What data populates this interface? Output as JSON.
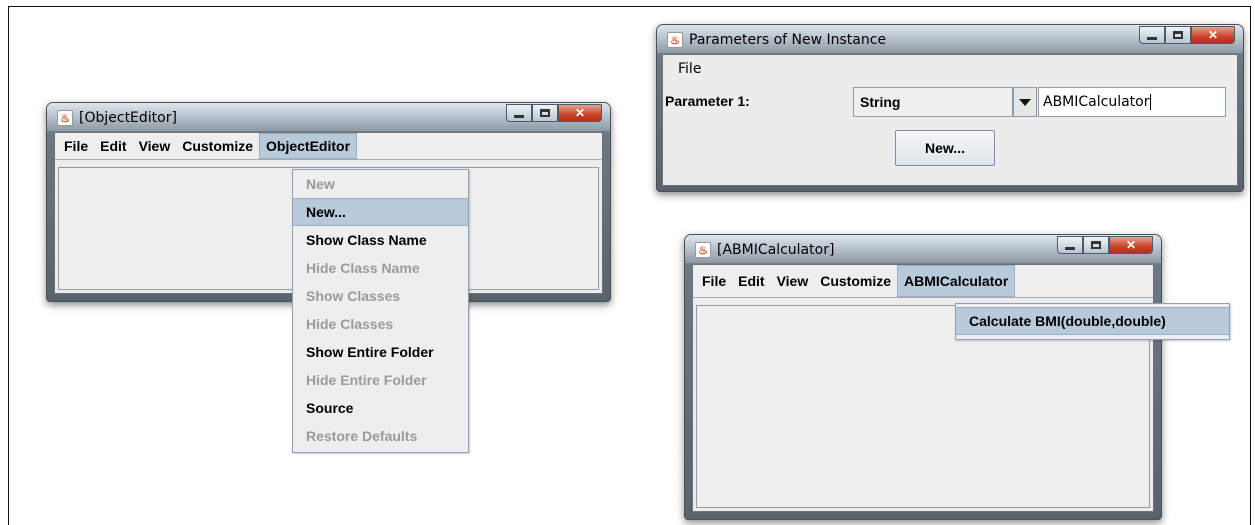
{
  "object_editor": {
    "title": "[ObjectEditor]",
    "menus": [
      "File",
      "Edit",
      "View",
      "Customize",
      "ObjectEditor"
    ],
    "active_menu": "ObjectEditor",
    "popup_items": [
      {
        "label": "New",
        "state": "disabled"
      },
      {
        "label": "New...",
        "state": "selected"
      },
      {
        "label": "Show Class Name",
        "state": "enabled"
      },
      {
        "label": "Hide Class Name",
        "state": "disabled"
      },
      {
        "label": "Show Classes",
        "state": "disabled"
      },
      {
        "label": "Hide Classes",
        "state": "disabled"
      },
      {
        "label": "Show Entire Folder",
        "state": "enabled"
      },
      {
        "label": "Hide Entire Folder",
        "state": "disabled"
      },
      {
        "label": "Source",
        "state": "enabled"
      },
      {
        "label": "Restore Defaults",
        "state": "disabled"
      }
    ]
  },
  "params_dialog": {
    "title": "Parameters of New Instance",
    "menus": [
      "File"
    ],
    "param_label": "Parameter 1:",
    "type_selected": "String",
    "value": "ABMICalculator",
    "button_label": "New..."
  },
  "abmi_window": {
    "title": "[ABMICalculator]",
    "menus": [
      "File",
      "Edit",
      "View",
      "Customize",
      "ABMICalculator"
    ],
    "active_menu": "ABMICalculator",
    "popup_items": [
      {
        "label": "Calculate BMI(double,double)",
        "state": "selected"
      }
    ]
  },
  "window_controls": {
    "minimize": "minimize-icon",
    "maximize": "maximize-icon",
    "close": "close-icon"
  },
  "colors": {
    "menu_highlight": "#b8c9da",
    "disabled_text": "#9a9a9a",
    "close_button": "#c8442a"
  }
}
